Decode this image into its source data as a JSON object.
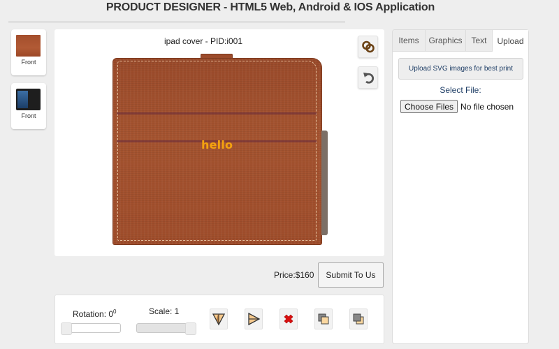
{
  "header": {
    "title": "PRODUCT DESIGNER - HTML5 Web, Android & IOS Application"
  },
  "views": [
    {
      "label": "Front",
      "thumbnail": "leather-cover-thumbnail"
    },
    {
      "label": "Front",
      "thumbnail": "ipad-case-thumbnail"
    }
  ],
  "canvas": {
    "product_title": "ipad cover - PID:i001",
    "text_element": "hello",
    "text_color": "#f4a20f",
    "tools": [
      {
        "name": "link-icon"
      },
      {
        "name": "rotate-icon"
      }
    ]
  },
  "order": {
    "price_label": "Price:$160",
    "submit_label": "Submit To Us"
  },
  "controls": {
    "rotation_label": "Rotation: 0",
    "rotation_unit": "0",
    "rotation_value": 0,
    "scale_label": "Scale: 1",
    "scale_value": 1,
    "buttons": [
      {
        "name": "flip-vertical-icon"
      },
      {
        "name": "flip-horizontal-icon"
      },
      {
        "name": "delete-icon"
      },
      {
        "name": "bring-forward-icon"
      },
      {
        "name": "send-backward-icon"
      }
    ]
  },
  "sidebar": {
    "tabs": [
      {
        "label": "Items"
      },
      {
        "label": "Graphics"
      },
      {
        "label": "Text"
      },
      {
        "label": "Upload",
        "active": true
      }
    ],
    "upload": {
      "hint": "Upload SVG images for best print",
      "select_label": "Select File:",
      "choose_button": "Choose Files",
      "file_status": "No file chosen"
    }
  }
}
